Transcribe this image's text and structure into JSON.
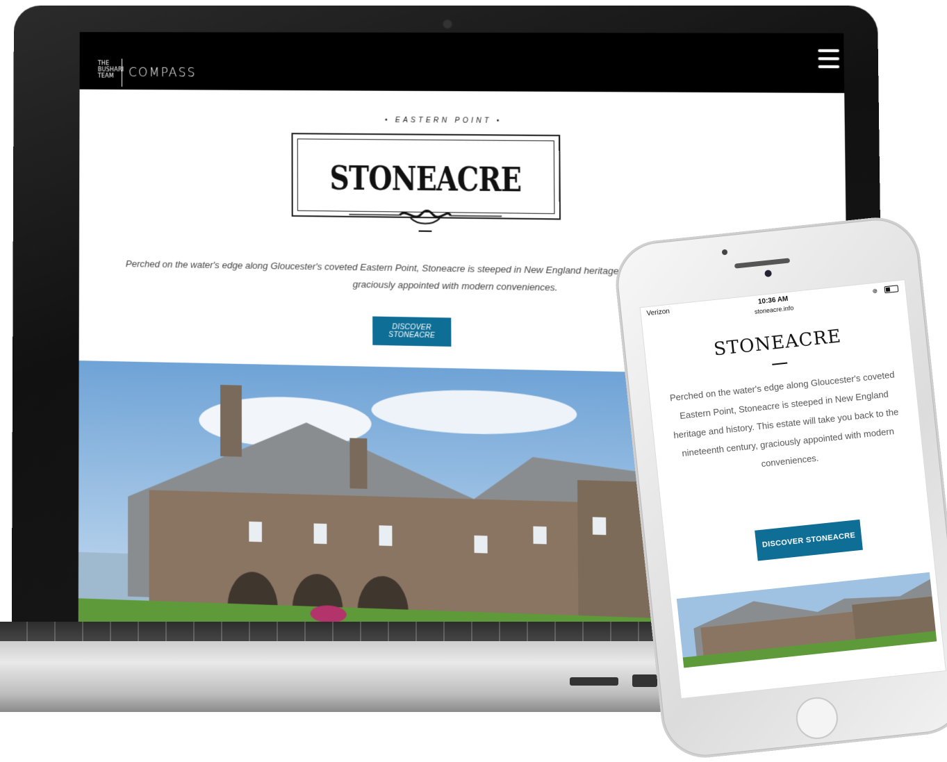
{
  "laptop": {
    "nav": {
      "brand_small": [
        "THE",
        "BUSHARI",
        "TEAM"
      ],
      "brand_main": "COMPASS",
      "menu_icon": "hamburger-icon"
    },
    "hero": {
      "eyebrow": "• EASTERN POINT •",
      "title": "STONEACRE",
      "intro_line1": "Perched on the water's edge along Gloucester's coveted Eastern Point, Stoneacre is steeped in New England heritage and history. This estate will take you bac",
      "intro_line2": "graciously appointed with modern conveniences.",
      "cta": "DISCOVER STONEACRE"
    }
  },
  "phone": {
    "status": {
      "carrier": "Verizon",
      "time": "10:36 AM",
      "url": "stoneacre.info"
    },
    "title": "STONEACRE",
    "intro": "Perched on the water's edge along Gloucester's coveted Eastern Point, Stoneacre is steeped in New England heritage and history. This estate will take you back to the nineteenth century, graciously appointed with modern conveniences.",
    "cta": "DISCOVER STONEACRE"
  },
  "colors": {
    "accent": "#0e6e95",
    "nav_bg": "#000000"
  }
}
